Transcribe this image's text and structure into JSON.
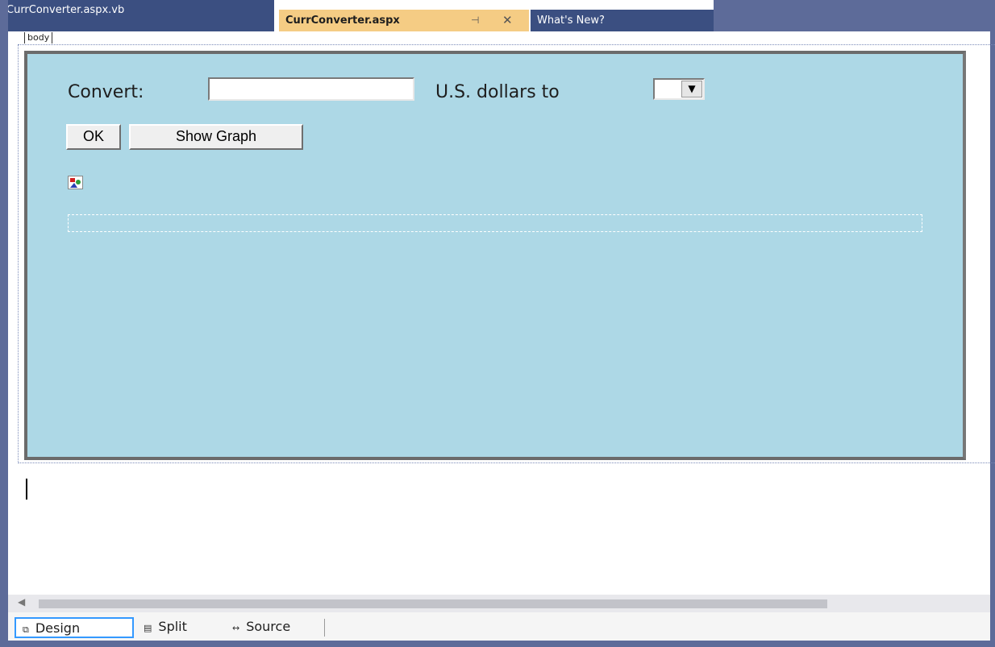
{
  "tabs": {
    "file_vb": "CurrConverter.aspx.vb",
    "file_aspx": "CurrConverter.aspx",
    "pin_glyph": "⊣",
    "close_glyph": "✕",
    "whats_new": "What's New?"
  },
  "breadcrumb": {
    "tag": "body"
  },
  "form": {
    "convert_label": "Convert:",
    "amount_value": "",
    "dollars_label": "U.S. dollars to",
    "currency_selected": "",
    "ok_label": "OK",
    "graph_label": "Show Graph"
  },
  "views": {
    "design": "Design",
    "split": "Split",
    "source": "Source"
  },
  "colors": {
    "surface": "#add8e6",
    "frame": "#5d6b99",
    "active_tab": "#f5cc84"
  }
}
